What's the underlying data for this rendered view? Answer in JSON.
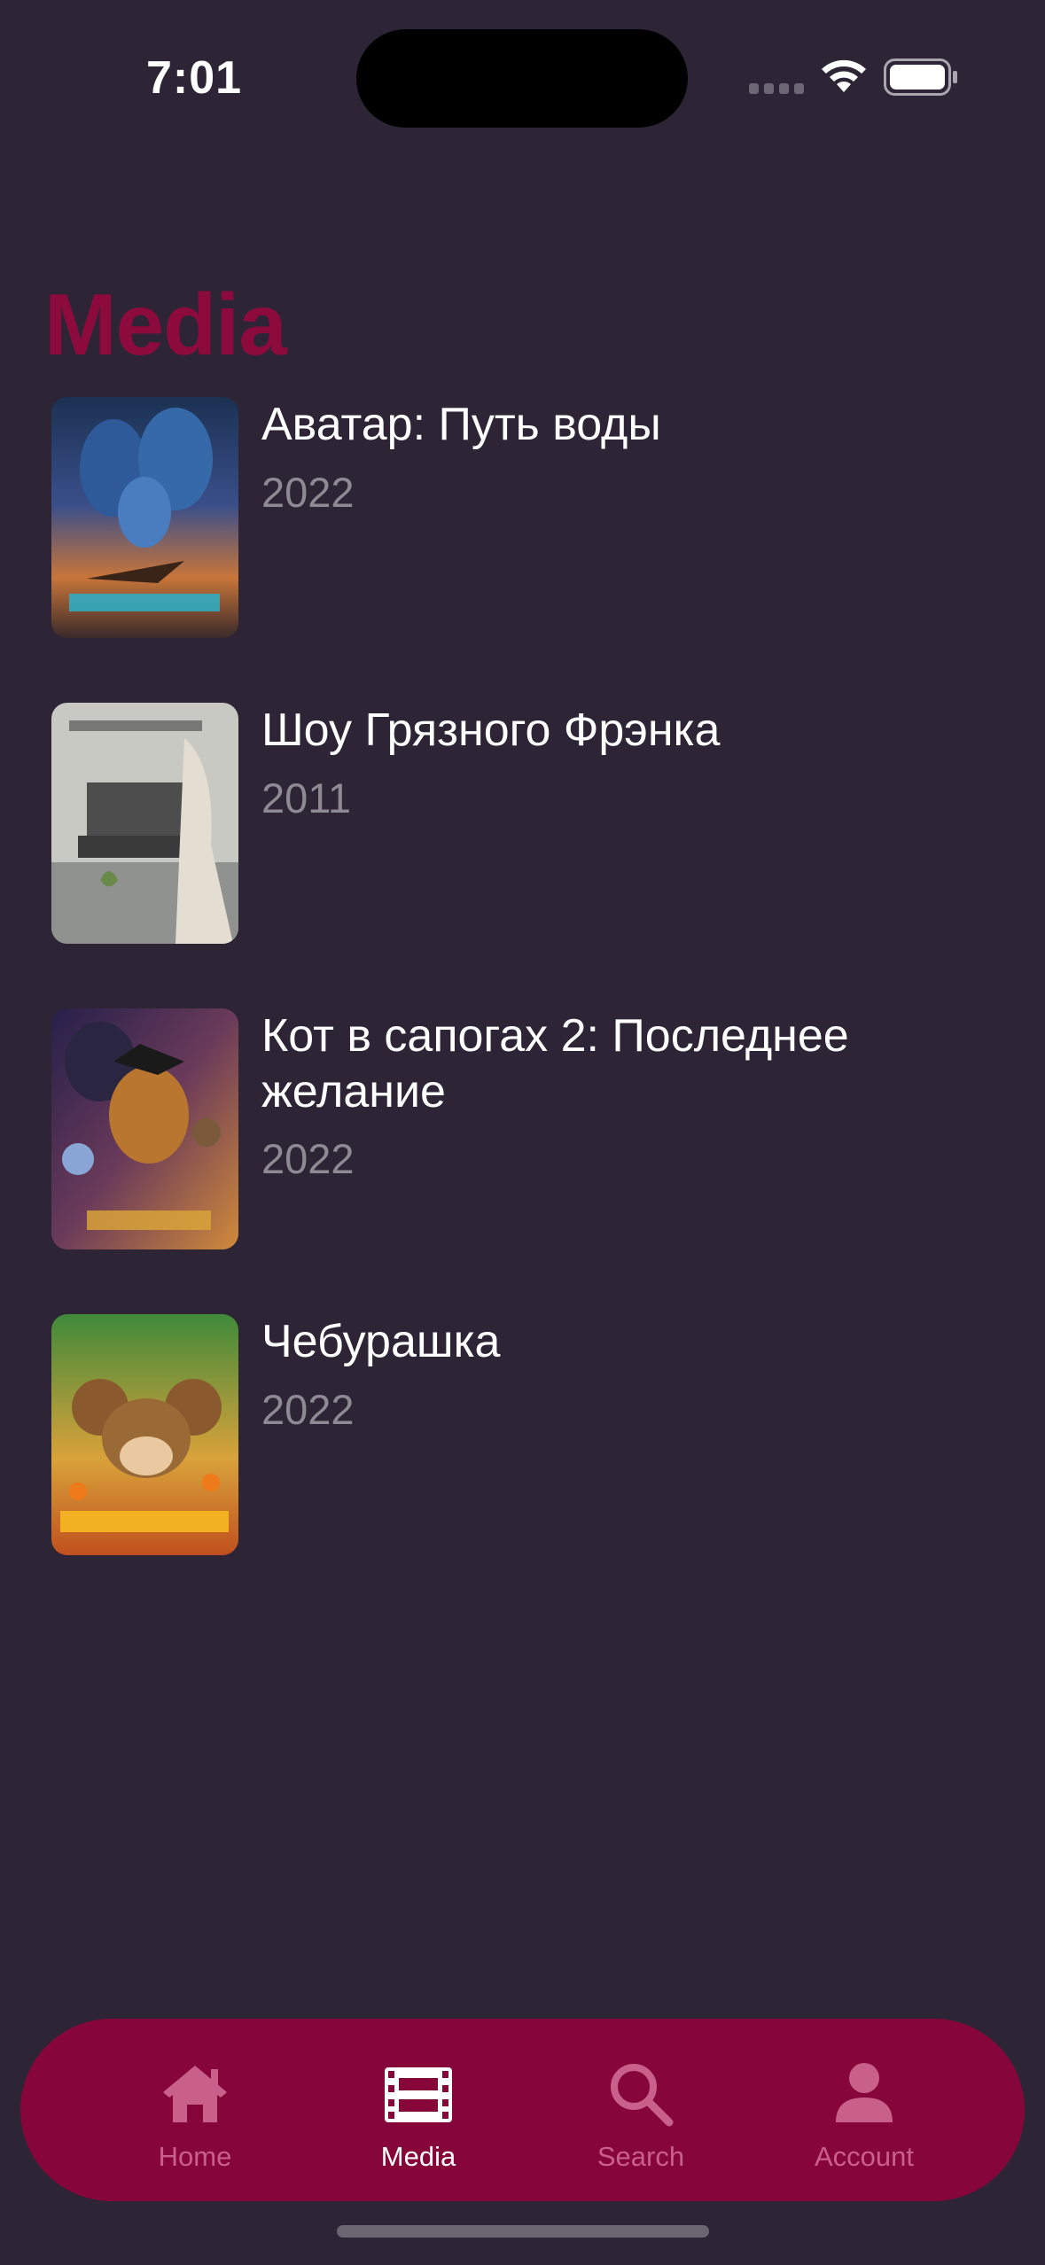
{
  "status_bar": {
    "time": "7:01"
  },
  "header": {
    "title": "Media"
  },
  "media": [
    {
      "title": "Аватар: Путь воды",
      "year": "2022"
    },
    {
      "title": "Шоу Грязного Фрэнка",
      "year": "2011"
    },
    {
      "title": "Кот в сапогах 2: Последнее желание",
      "year": "2022"
    },
    {
      "title": "Чебурашка",
      "year": "2022"
    }
  ],
  "tabs": [
    {
      "label": "Home",
      "icon": "house-icon"
    },
    {
      "label": "Media",
      "icon": "film-icon",
      "active": true
    },
    {
      "label": "Search",
      "icon": "magnifier-icon"
    },
    {
      "label": "Account",
      "icon": "person-icon"
    }
  ],
  "colors": {
    "background": "#2d2535",
    "accent": "#8c0a3c",
    "tab_bar": "#86063a",
    "tab_inactive": "#c9608a",
    "secondary_text": "#8e8a93"
  }
}
